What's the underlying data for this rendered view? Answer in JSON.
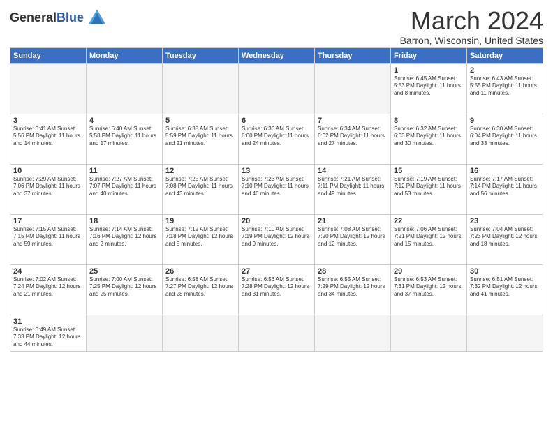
{
  "logo": {
    "text_general": "General",
    "text_blue": "Blue"
  },
  "header": {
    "title": "March 2024",
    "subtitle": "Barron, Wisconsin, United States"
  },
  "days_of_week": [
    "Sunday",
    "Monday",
    "Tuesday",
    "Wednesday",
    "Thursday",
    "Friday",
    "Saturday"
  ],
  "weeks": [
    [
      {
        "day": "",
        "info": ""
      },
      {
        "day": "",
        "info": ""
      },
      {
        "day": "",
        "info": ""
      },
      {
        "day": "",
        "info": ""
      },
      {
        "day": "",
        "info": ""
      },
      {
        "day": "1",
        "info": "Sunrise: 6:45 AM\nSunset: 5:53 PM\nDaylight: 11 hours\nand 8 minutes."
      },
      {
        "day": "2",
        "info": "Sunrise: 6:43 AM\nSunset: 5:55 PM\nDaylight: 11 hours\nand 11 minutes."
      }
    ],
    [
      {
        "day": "3",
        "info": "Sunrise: 6:41 AM\nSunset: 5:56 PM\nDaylight: 11 hours\nand 14 minutes."
      },
      {
        "day": "4",
        "info": "Sunrise: 6:40 AM\nSunset: 5:58 PM\nDaylight: 11 hours\nand 17 minutes."
      },
      {
        "day": "5",
        "info": "Sunrise: 6:38 AM\nSunset: 5:59 PM\nDaylight: 11 hours\nand 21 minutes."
      },
      {
        "day": "6",
        "info": "Sunrise: 6:36 AM\nSunset: 6:00 PM\nDaylight: 11 hours\nand 24 minutes."
      },
      {
        "day": "7",
        "info": "Sunrise: 6:34 AM\nSunset: 6:02 PM\nDaylight: 11 hours\nand 27 minutes."
      },
      {
        "day": "8",
        "info": "Sunrise: 6:32 AM\nSunset: 6:03 PM\nDaylight: 11 hours\nand 30 minutes."
      },
      {
        "day": "9",
        "info": "Sunrise: 6:30 AM\nSunset: 6:04 PM\nDaylight: 11 hours\nand 33 minutes."
      }
    ],
    [
      {
        "day": "10",
        "info": "Sunrise: 7:29 AM\nSunset: 7:06 PM\nDaylight: 11 hours\nand 37 minutes."
      },
      {
        "day": "11",
        "info": "Sunrise: 7:27 AM\nSunset: 7:07 PM\nDaylight: 11 hours\nand 40 minutes."
      },
      {
        "day": "12",
        "info": "Sunrise: 7:25 AM\nSunset: 7:08 PM\nDaylight: 11 hours\nand 43 minutes."
      },
      {
        "day": "13",
        "info": "Sunrise: 7:23 AM\nSunset: 7:10 PM\nDaylight: 11 hours\nand 46 minutes."
      },
      {
        "day": "14",
        "info": "Sunrise: 7:21 AM\nSunset: 7:11 PM\nDaylight: 11 hours\nand 49 minutes."
      },
      {
        "day": "15",
        "info": "Sunrise: 7:19 AM\nSunset: 7:12 PM\nDaylight: 11 hours\nand 53 minutes."
      },
      {
        "day": "16",
        "info": "Sunrise: 7:17 AM\nSunset: 7:14 PM\nDaylight: 11 hours\nand 56 minutes."
      }
    ],
    [
      {
        "day": "17",
        "info": "Sunrise: 7:15 AM\nSunset: 7:15 PM\nDaylight: 11 hours\nand 59 minutes."
      },
      {
        "day": "18",
        "info": "Sunrise: 7:14 AM\nSunset: 7:16 PM\nDaylight: 12 hours\nand 2 minutes."
      },
      {
        "day": "19",
        "info": "Sunrise: 7:12 AM\nSunset: 7:18 PM\nDaylight: 12 hours\nand 5 minutes."
      },
      {
        "day": "20",
        "info": "Sunrise: 7:10 AM\nSunset: 7:19 PM\nDaylight: 12 hours\nand 9 minutes."
      },
      {
        "day": "21",
        "info": "Sunrise: 7:08 AM\nSunset: 7:20 PM\nDaylight: 12 hours\nand 12 minutes."
      },
      {
        "day": "22",
        "info": "Sunrise: 7:06 AM\nSunset: 7:21 PM\nDaylight: 12 hours\nand 15 minutes."
      },
      {
        "day": "23",
        "info": "Sunrise: 7:04 AM\nSunset: 7:23 PM\nDaylight: 12 hours\nand 18 minutes."
      }
    ],
    [
      {
        "day": "24",
        "info": "Sunrise: 7:02 AM\nSunset: 7:24 PM\nDaylight: 12 hours\nand 21 minutes."
      },
      {
        "day": "25",
        "info": "Sunrise: 7:00 AM\nSunset: 7:25 PM\nDaylight: 12 hours\nand 25 minutes."
      },
      {
        "day": "26",
        "info": "Sunrise: 6:58 AM\nSunset: 7:27 PM\nDaylight: 12 hours\nand 28 minutes."
      },
      {
        "day": "27",
        "info": "Sunrise: 6:56 AM\nSunset: 7:28 PM\nDaylight: 12 hours\nand 31 minutes."
      },
      {
        "day": "28",
        "info": "Sunrise: 6:55 AM\nSunset: 7:29 PM\nDaylight: 12 hours\nand 34 minutes."
      },
      {
        "day": "29",
        "info": "Sunrise: 6:53 AM\nSunset: 7:31 PM\nDaylight: 12 hours\nand 37 minutes."
      },
      {
        "day": "30",
        "info": "Sunrise: 6:51 AM\nSunset: 7:32 PM\nDaylight: 12 hours\nand 41 minutes."
      }
    ],
    [
      {
        "day": "31",
        "info": "Sunrise: 6:49 AM\nSunset: 7:33 PM\nDaylight: 12 hours\nand 44 minutes."
      },
      {
        "day": "",
        "info": ""
      },
      {
        "day": "",
        "info": ""
      },
      {
        "day": "",
        "info": ""
      },
      {
        "day": "",
        "info": ""
      },
      {
        "day": "",
        "info": ""
      },
      {
        "day": "",
        "info": ""
      }
    ]
  ]
}
